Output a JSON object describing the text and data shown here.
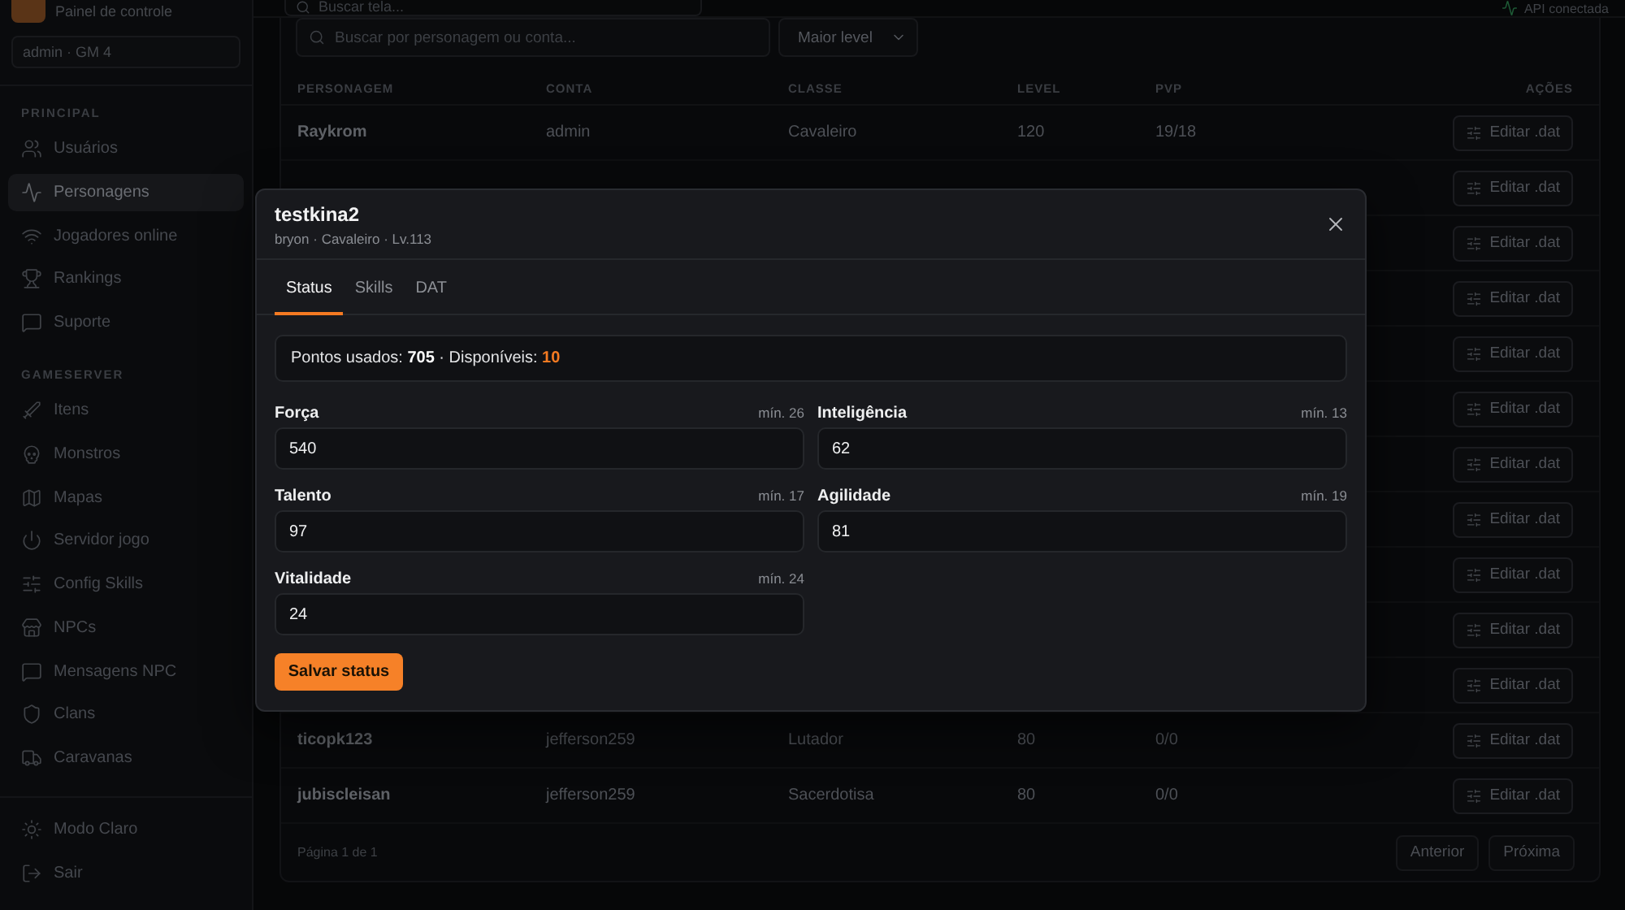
{
  "sidebar": {
    "brand": {
      "subtitle": "Painel de controle"
    },
    "user_badge": "admin · GM 4",
    "sections": [
      {
        "title": "PRINCIPAL",
        "items": [
          {
            "label": "Usuários",
            "selected": false
          },
          {
            "label": "Personagens",
            "selected": true
          },
          {
            "label": "Jogadores online",
            "selected": false
          },
          {
            "label": "Rankings",
            "selected": false
          },
          {
            "label": "Suporte",
            "selected": false
          }
        ]
      },
      {
        "title": "GAMESERVER",
        "items": [
          {
            "label": "Itens",
            "selected": false
          },
          {
            "label": "Monstros",
            "selected": false
          },
          {
            "label": "Mapas",
            "selected": false
          },
          {
            "label": "Servidor jogo",
            "selected": false
          },
          {
            "label": "Config Skills",
            "selected": false
          },
          {
            "label": "NPCs",
            "selected": false
          },
          {
            "label": "Mensagens NPC",
            "selected": false
          },
          {
            "label": "Clans",
            "selected": false
          },
          {
            "label": "Caravanas",
            "selected": false
          }
        ]
      }
    ],
    "footer_items": [
      {
        "label": "Modo Claro"
      },
      {
        "label": "Sair"
      }
    ]
  },
  "topbar": {
    "search": {
      "placeholder": "Buscar tela..."
    },
    "status": "API conectada"
  },
  "filters": {
    "search": {
      "placeholder": "Buscar por personagem ou conta..."
    },
    "sort": {
      "value": "Maior level"
    }
  },
  "table": {
    "columns": [
      "PERSONAGEM",
      "CONTA",
      "CLASSE",
      "LEVEL",
      "PVP",
      "AÇÕES"
    ],
    "rows": [
      {
        "cells": [
          "Raykrom",
          "admin",
          "Cavaleiro",
          "120",
          "19/18"
        ],
        "action": "Editar .dat"
      },
      {
        "action": "Editar .dat"
      },
      {
        "action": "Editar .dat"
      },
      {
        "action": "Editar .dat"
      },
      {
        "action": "Editar .dat"
      },
      {
        "action": "Editar .dat"
      },
      {
        "action": "Editar .dat"
      },
      {
        "action": "Editar .dat"
      },
      {
        "action": "Editar .dat"
      },
      {
        "action": "Editar .dat"
      },
      {
        "action": "Editar .dat"
      },
      {
        "cells": [
          "ticopk123",
          "jefferson259",
          "Lutador",
          "80",
          "0/0"
        ],
        "action": "Editar .dat"
      },
      {
        "cells": [
          "jubiscleisan",
          "jefferson259",
          "Sacerdotisa",
          "80",
          "0/0"
        ],
        "action": "Editar .dat"
      }
    ]
  },
  "pagination": {
    "info": "Página 1 de 1",
    "buttons": [
      {
        "label": "Anterior",
        "disabled": true
      },
      {
        "label": "Próxima",
        "disabled": true
      }
    ]
  },
  "modal": {
    "title": "testkina2",
    "subtitle": "bryon · Cavaleiro · Lv.113",
    "tabs": [
      {
        "label": "Status",
        "selected": true
      },
      {
        "label": "Skills",
        "selected": false
      },
      {
        "label": "DAT",
        "selected": false
      }
    ],
    "points": "Pontos usados: **705** · Disponíveis: **10**",
    "stats": [
      {
        "label": "Força",
        "min": "mín. 26",
        "value": "540"
      },
      {
        "label": "Inteligência",
        "min": "mín. 13",
        "value": "62"
      },
      {
        "label": "Talento",
        "min": "mín. 17",
        "value": "97"
      },
      {
        "label": "Agilidade",
        "min": "mín. 19",
        "value": "81"
      },
      {
        "label": "Vitalidade",
        "min": "mín. 24",
        "value": "24"
      }
    ],
    "save_button": "Salvar status"
  }
}
